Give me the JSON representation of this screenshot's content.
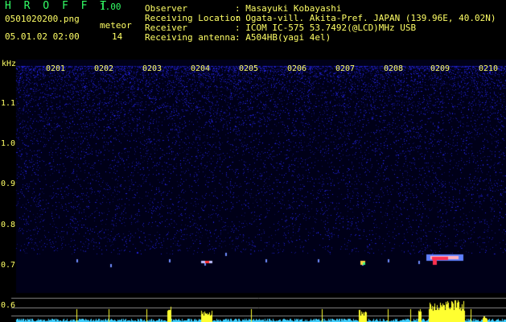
{
  "header": {
    "logo": "H R O F F T",
    "version": "1.00",
    "filename": "0501020200.png",
    "meteor_label": "meteor",
    "datetime": "05.01.02 02:00",
    "meteor_count": "14",
    "fields": [
      {
        "label": "Observer",
        "value": ": Masayuki Kobayashi"
      },
      {
        "label": "Receiving Location",
        "value": ": Ogata-vill. Akita-Pref. JAPAN (139.96E, 40.02N)"
      },
      {
        "label": "Receiver",
        "value": ": ICOM IC-575 53.7492(@LCD)MHz USB"
      },
      {
        "label": "Receiving antenna",
        "value": ": A504HB(yagi 4el)"
      }
    ]
  },
  "axis": {
    "unit": "kHz",
    "freq_labels": [
      "1.1",
      "1.0",
      "0.9",
      "0.8",
      "0.7",
      "0.6"
    ],
    "time_labels": [
      "0201",
      "0202",
      "0203",
      "0204",
      "0205",
      "0206",
      "0207",
      "0208",
      "0209",
      "0210"
    ]
  },
  "colors": {
    "text_green": "#33ff66",
    "text_yellow": "#ffff66",
    "background": "#000000",
    "noise_blue": "#1e1eb4",
    "signal_yellow": "#ffff00",
    "signal_red": "#ff3030"
  }
}
